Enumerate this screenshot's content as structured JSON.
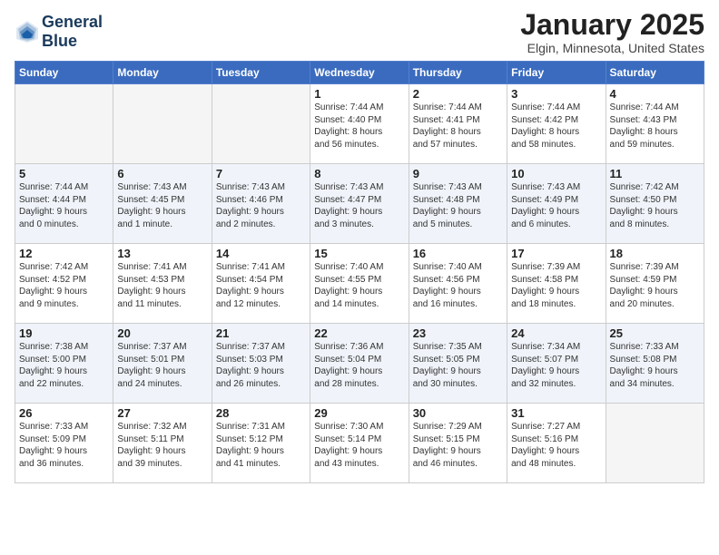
{
  "header": {
    "logo_line1": "General",
    "logo_line2": "Blue",
    "month_title": "January 2025",
    "location": "Elgin, Minnesota, United States"
  },
  "days_of_week": [
    "Sunday",
    "Monday",
    "Tuesday",
    "Wednesday",
    "Thursday",
    "Friday",
    "Saturday"
  ],
  "weeks": [
    [
      {
        "day": "",
        "info": ""
      },
      {
        "day": "",
        "info": ""
      },
      {
        "day": "",
        "info": ""
      },
      {
        "day": "1",
        "info": "Sunrise: 7:44 AM\nSunset: 4:40 PM\nDaylight: 8 hours\nand 56 minutes."
      },
      {
        "day": "2",
        "info": "Sunrise: 7:44 AM\nSunset: 4:41 PM\nDaylight: 8 hours\nand 57 minutes."
      },
      {
        "day": "3",
        "info": "Sunrise: 7:44 AM\nSunset: 4:42 PM\nDaylight: 8 hours\nand 58 minutes."
      },
      {
        "day": "4",
        "info": "Sunrise: 7:44 AM\nSunset: 4:43 PM\nDaylight: 8 hours\nand 59 minutes."
      }
    ],
    [
      {
        "day": "5",
        "info": "Sunrise: 7:44 AM\nSunset: 4:44 PM\nDaylight: 9 hours\nand 0 minutes."
      },
      {
        "day": "6",
        "info": "Sunrise: 7:43 AM\nSunset: 4:45 PM\nDaylight: 9 hours\nand 1 minute."
      },
      {
        "day": "7",
        "info": "Sunrise: 7:43 AM\nSunset: 4:46 PM\nDaylight: 9 hours\nand 2 minutes."
      },
      {
        "day": "8",
        "info": "Sunrise: 7:43 AM\nSunset: 4:47 PM\nDaylight: 9 hours\nand 3 minutes."
      },
      {
        "day": "9",
        "info": "Sunrise: 7:43 AM\nSunset: 4:48 PM\nDaylight: 9 hours\nand 5 minutes."
      },
      {
        "day": "10",
        "info": "Sunrise: 7:43 AM\nSunset: 4:49 PM\nDaylight: 9 hours\nand 6 minutes."
      },
      {
        "day": "11",
        "info": "Sunrise: 7:42 AM\nSunset: 4:50 PM\nDaylight: 9 hours\nand 8 minutes."
      }
    ],
    [
      {
        "day": "12",
        "info": "Sunrise: 7:42 AM\nSunset: 4:52 PM\nDaylight: 9 hours\nand 9 minutes."
      },
      {
        "day": "13",
        "info": "Sunrise: 7:41 AM\nSunset: 4:53 PM\nDaylight: 9 hours\nand 11 minutes."
      },
      {
        "day": "14",
        "info": "Sunrise: 7:41 AM\nSunset: 4:54 PM\nDaylight: 9 hours\nand 12 minutes."
      },
      {
        "day": "15",
        "info": "Sunrise: 7:40 AM\nSunset: 4:55 PM\nDaylight: 9 hours\nand 14 minutes."
      },
      {
        "day": "16",
        "info": "Sunrise: 7:40 AM\nSunset: 4:56 PM\nDaylight: 9 hours\nand 16 minutes."
      },
      {
        "day": "17",
        "info": "Sunrise: 7:39 AM\nSunset: 4:58 PM\nDaylight: 9 hours\nand 18 minutes."
      },
      {
        "day": "18",
        "info": "Sunrise: 7:39 AM\nSunset: 4:59 PM\nDaylight: 9 hours\nand 20 minutes."
      }
    ],
    [
      {
        "day": "19",
        "info": "Sunrise: 7:38 AM\nSunset: 5:00 PM\nDaylight: 9 hours\nand 22 minutes."
      },
      {
        "day": "20",
        "info": "Sunrise: 7:37 AM\nSunset: 5:01 PM\nDaylight: 9 hours\nand 24 minutes."
      },
      {
        "day": "21",
        "info": "Sunrise: 7:37 AM\nSunset: 5:03 PM\nDaylight: 9 hours\nand 26 minutes."
      },
      {
        "day": "22",
        "info": "Sunrise: 7:36 AM\nSunset: 5:04 PM\nDaylight: 9 hours\nand 28 minutes."
      },
      {
        "day": "23",
        "info": "Sunrise: 7:35 AM\nSunset: 5:05 PM\nDaylight: 9 hours\nand 30 minutes."
      },
      {
        "day": "24",
        "info": "Sunrise: 7:34 AM\nSunset: 5:07 PM\nDaylight: 9 hours\nand 32 minutes."
      },
      {
        "day": "25",
        "info": "Sunrise: 7:33 AM\nSunset: 5:08 PM\nDaylight: 9 hours\nand 34 minutes."
      }
    ],
    [
      {
        "day": "26",
        "info": "Sunrise: 7:33 AM\nSunset: 5:09 PM\nDaylight: 9 hours\nand 36 minutes."
      },
      {
        "day": "27",
        "info": "Sunrise: 7:32 AM\nSunset: 5:11 PM\nDaylight: 9 hours\nand 39 minutes."
      },
      {
        "day": "28",
        "info": "Sunrise: 7:31 AM\nSunset: 5:12 PM\nDaylight: 9 hours\nand 41 minutes."
      },
      {
        "day": "29",
        "info": "Sunrise: 7:30 AM\nSunset: 5:14 PM\nDaylight: 9 hours\nand 43 minutes."
      },
      {
        "day": "30",
        "info": "Sunrise: 7:29 AM\nSunset: 5:15 PM\nDaylight: 9 hours\nand 46 minutes."
      },
      {
        "day": "31",
        "info": "Sunrise: 7:27 AM\nSunset: 5:16 PM\nDaylight: 9 hours\nand 48 minutes."
      },
      {
        "day": "",
        "info": ""
      }
    ]
  ]
}
